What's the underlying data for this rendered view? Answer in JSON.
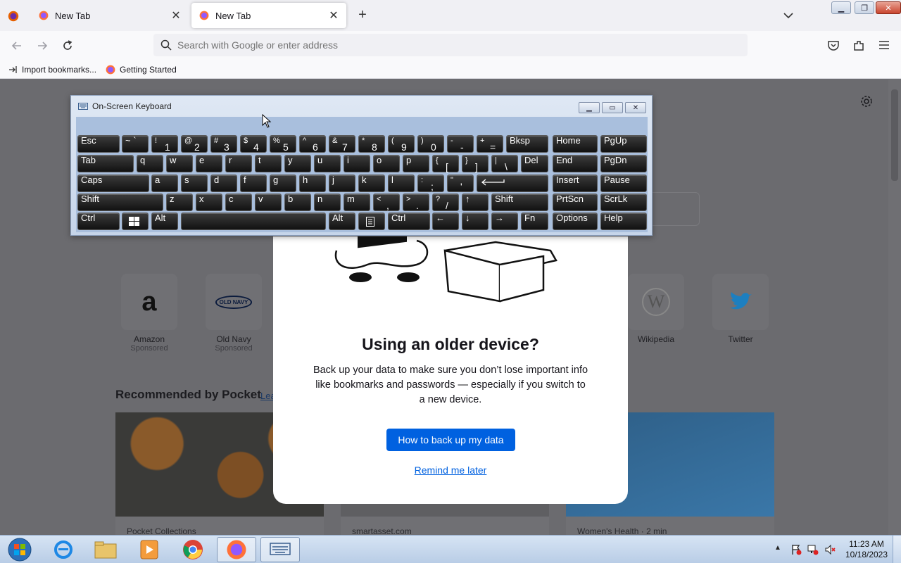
{
  "browser": {
    "tabs": [
      {
        "label": "New Tab",
        "active": false
      },
      {
        "label": "New Tab",
        "active": true
      }
    ],
    "url_placeholder": "Search with Google or enter address",
    "bookmarks": [
      {
        "label": "Import bookmarks...",
        "icon": "import-icon"
      },
      {
        "label": "Getting Started",
        "icon": "firefox-icon"
      }
    ]
  },
  "newtab": {
    "sites": [
      {
        "name": "Amazon",
        "sponsored": "Sponsored",
        "logo_text": "a"
      },
      {
        "name": "Old Navy",
        "sponsored": "Sponsored",
        "logo_text": "OLD NAVY"
      },
      {
        "name": "Wikipedia",
        "sponsored": "",
        "logo_text": "W"
      },
      {
        "name": "Twitter",
        "sponsored": "",
        "logo_text": ""
      }
    ],
    "pocket_title": "Recommended by Pocket",
    "pocket_learn": "Lea",
    "cards": [
      {
        "meta": "Pocket Collections"
      },
      {
        "meta": "smartasset.com"
      },
      {
        "meta": "Women's Health · 2 min"
      }
    ]
  },
  "modal": {
    "title": "Using an older device?",
    "body": "Back up your data to make sure you don’t lose important info like bookmarks and passwords — especially if you switch to a new device.",
    "primary_button": "How to back up my data",
    "secondary_link": "Remind me later"
  },
  "osk": {
    "title": "On-Screen Keyboard",
    "keys": {
      "esc": "Esc",
      "tab": "Tab",
      "caps": "Caps",
      "shift": "Shift",
      "ctrl": "Ctrl",
      "alt": "Alt",
      "bksp": "Bksp",
      "del": "Del",
      "home": "Home",
      "pgup": "PgUp",
      "end": "End",
      "pgdn": "PgDn",
      "insert": "Insert",
      "pause": "Pause",
      "prtscn": "PrtScn",
      "scrlk": "ScrLk",
      "options": "Options",
      "help": "Help",
      "fn": "Fn"
    }
  },
  "taskbar": {
    "time": "11:23 AM",
    "date": "10/18/2023"
  }
}
